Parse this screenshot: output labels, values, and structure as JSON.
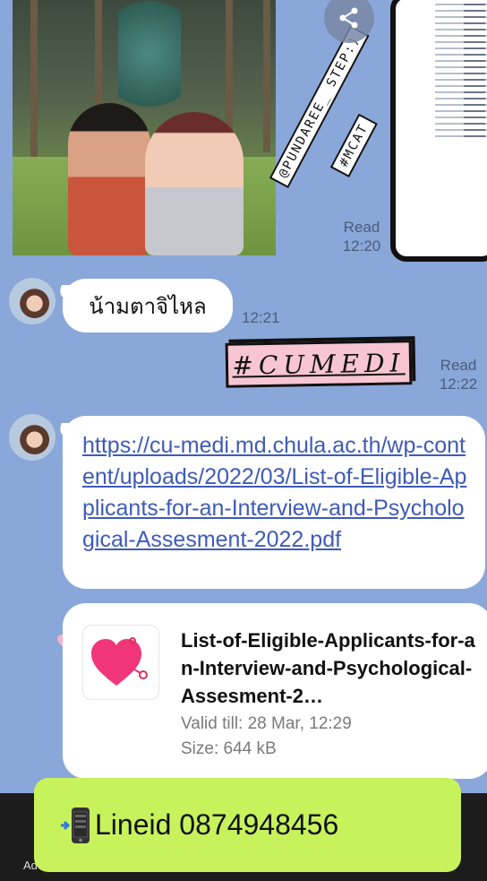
{
  "chat": {
    "photo_message": {
      "status": "Read",
      "time": "12:20"
    },
    "stickers": {
      "handle": "@PUNDAREE_ STEP:)",
      "hashtag": "#MCAT"
    },
    "incoming_text": {
      "text": "น้ามตาจิไหล",
      "time": "12:21"
    },
    "tag_message": {
      "text": "#CUMEDI",
      "status": "Read",
      "time": "12:22"
    },
    "link_message": {
      "url": "https://cu-medi.md.chula.ac.th/wp-content/uploads/2022/03/List-of-Eligible-Applicants-for-an-Interview-and-Psychological-Assesment-2022.pdf"
    },
    "file_message": {
      "name": "List-of-Eligible-Applicants-for-an-Interview-and-Psychological-Assesment-2…",
      "valid_till": "Valid till: 28 Mar, 12:29",
      "size": "Size: 644 kB"
    }
  },
  "banner": {
    "text": "Lineid 0874948456"
  },
  "bottom_bar": {
    "label": "Ad"
  },
  "colors": {
    "chat_background": "#8aa7d9",
    "link": "#3e5bb8",
    "banner": "#c7f25c",
    "sticker_pink": "#f7c6d2"
  },
  "icons": [
    "share-icon",
    "phone-icon",
    "heart-file-icon",
    "heart-sticker-icon"
  ]
}
